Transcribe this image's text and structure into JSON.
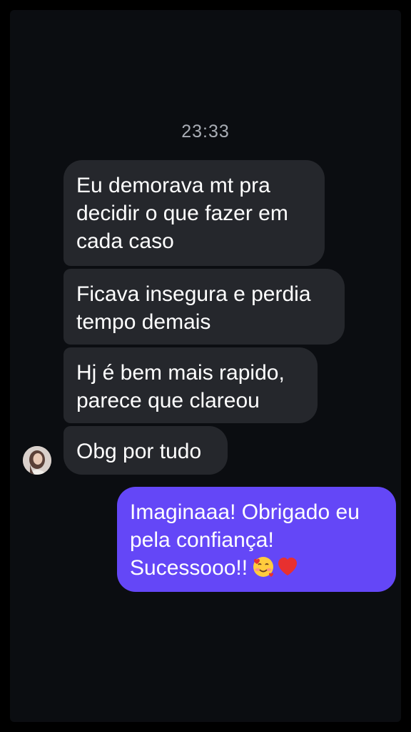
{
  "conversation": {
    "timestamp": "23:33",
    "messages": [
      {
        "direction": "incoming",
        "text": "Eu demorava mt pra\ndecidir o que fazer em\ncada caso"
      },
      {
        "direction": "incoming",
        "text": "Ficava insegura e perdia\ntempo demais"
      },
      {
        "direction": "incoming",
        "text": "Hj é bem mais rapido,\nparece que clareou"
      },
      {
        "direction": "incoming",
        "text": "Obg por tudo"
      },
      {
        "direction": "outgoing",
        "text": "Imaginaaa! Obrigado eu\npela confiança!\nSucessooo!!",
        "emojis": [
          "smiling-face-with-hearts-icon",
          "red-heart-icon"
        ]
      }
    ]
  },
  "colors": {
    "background": "#0b0d11",
    "incoming_bubble": "#25272c",
    "outgoing_bubble": "#6447f7",
    "timestamp_text": "#a9adb5"
  }
}
